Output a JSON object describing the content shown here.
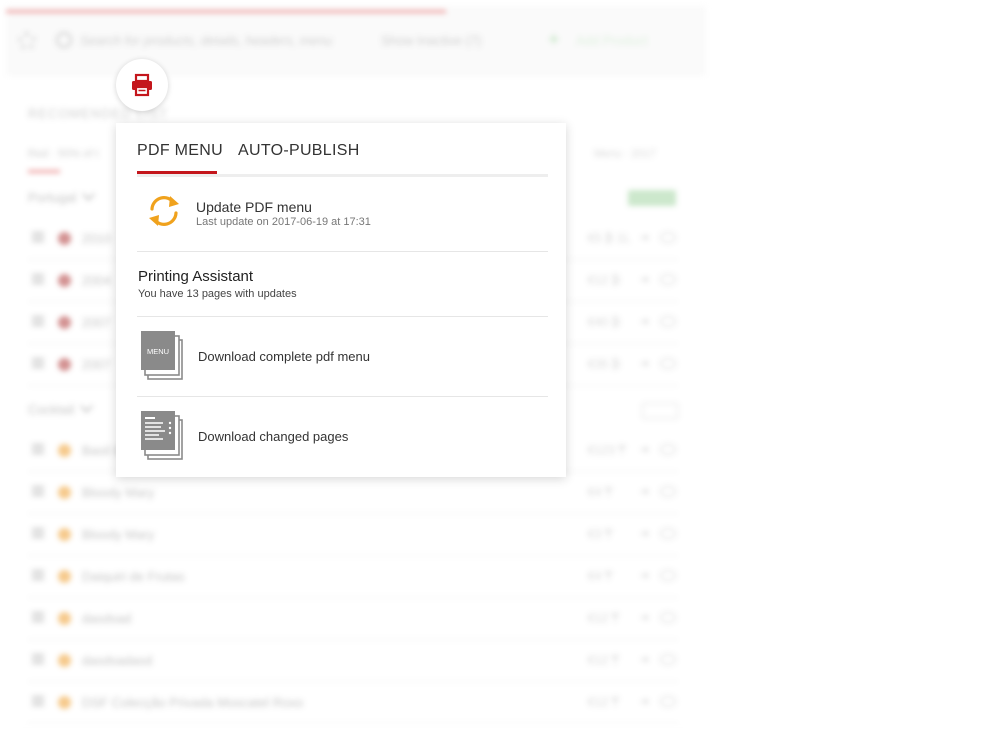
{
  "background": {
    "search_placeholder": "Search for products, details, headers, menu",
    "show_inactive": "Show Inactive (7)",
    "add_label": "Add Product",
    "heading": "RECOMENDED LIST",
    "filter_text": "Red  ·  50% of t",
    "filter_right": "Menu  ·  2017",
    "groups": [
      {
        "name": "Portugal"
      },
      {
        "name": "Cocktail"
      }
    ],
    "rows": [
      {
        "name": "2010",
        "price": "€5 ₿ 1L",
        "dot_color": "#b03a3a"
      },
      {
        "name": "2004",
        "price": "€12 ₿",
        "dot_color": "#b03a3a"
      },
      {
        "name": "2007",
        "price": "€40 ₿",
        "dot_color": "#b03a3a"
      },
      {
        "name": "2007",
        "price": "€35 ₿",
        "dot_color": "#b03a3a"
      },
      {
        "name": "Basil E",
        "price": "€123 ₸",
        "dot_color": "#f0a030"
      },
      {
        "name": "Bloody Mary",
        "price": "€4 ₸",
        "dot_color": "#f0a030"
      },
      {
        "name": "Bloody Mary",
        "price": "€3 ₸",
        "dot_color": "#f0a030"
      },
      {
        "name": "Daiquiri de Frutas",
        "price": "€4 ₸",
        "dot_color": "#f0a030"
      },
      {
        "name": "dasdsad",
        "price": "€12 ₸",
        "dot_color": "#f0a030"
      },
      {
        "name": "dasdsadasd",
        "price": "€12 ₸",
        "dot_color": "#f0a030"
      },
      {
        "name": "DSF Colecção Privada Moscatel Roxo",
        "price": "€12 ₸",
        "dot_color": "#f0a030"
      }
    ]
  },
  "popover": {
    "tabs": [
      {
        "label": "PDF MENU"
      },
      {
        "label": "AUTO-PUBLISH"
      }
    ],
    "update": {
      "title": "Update PDF menu",
      "subtitle": "Last update on 2017-06-19 at 17:31"
    },
    "assistant": {
      "title": "Printing Assistant",
      "subtitle": "You have 13 pages with updates"
    },
    "download_complete": {
      "label": "Download complete pdf menu",
      "icon_text": "MENU"
    },
    "download_changed": {
      "label": "Download changed pages"
    }
  },
  "colors": {
    "accent": "#c4161c",
    "refresh_icon": "#f0a21d",
    "doc_icon": "#8a8a8a"
  }
}
